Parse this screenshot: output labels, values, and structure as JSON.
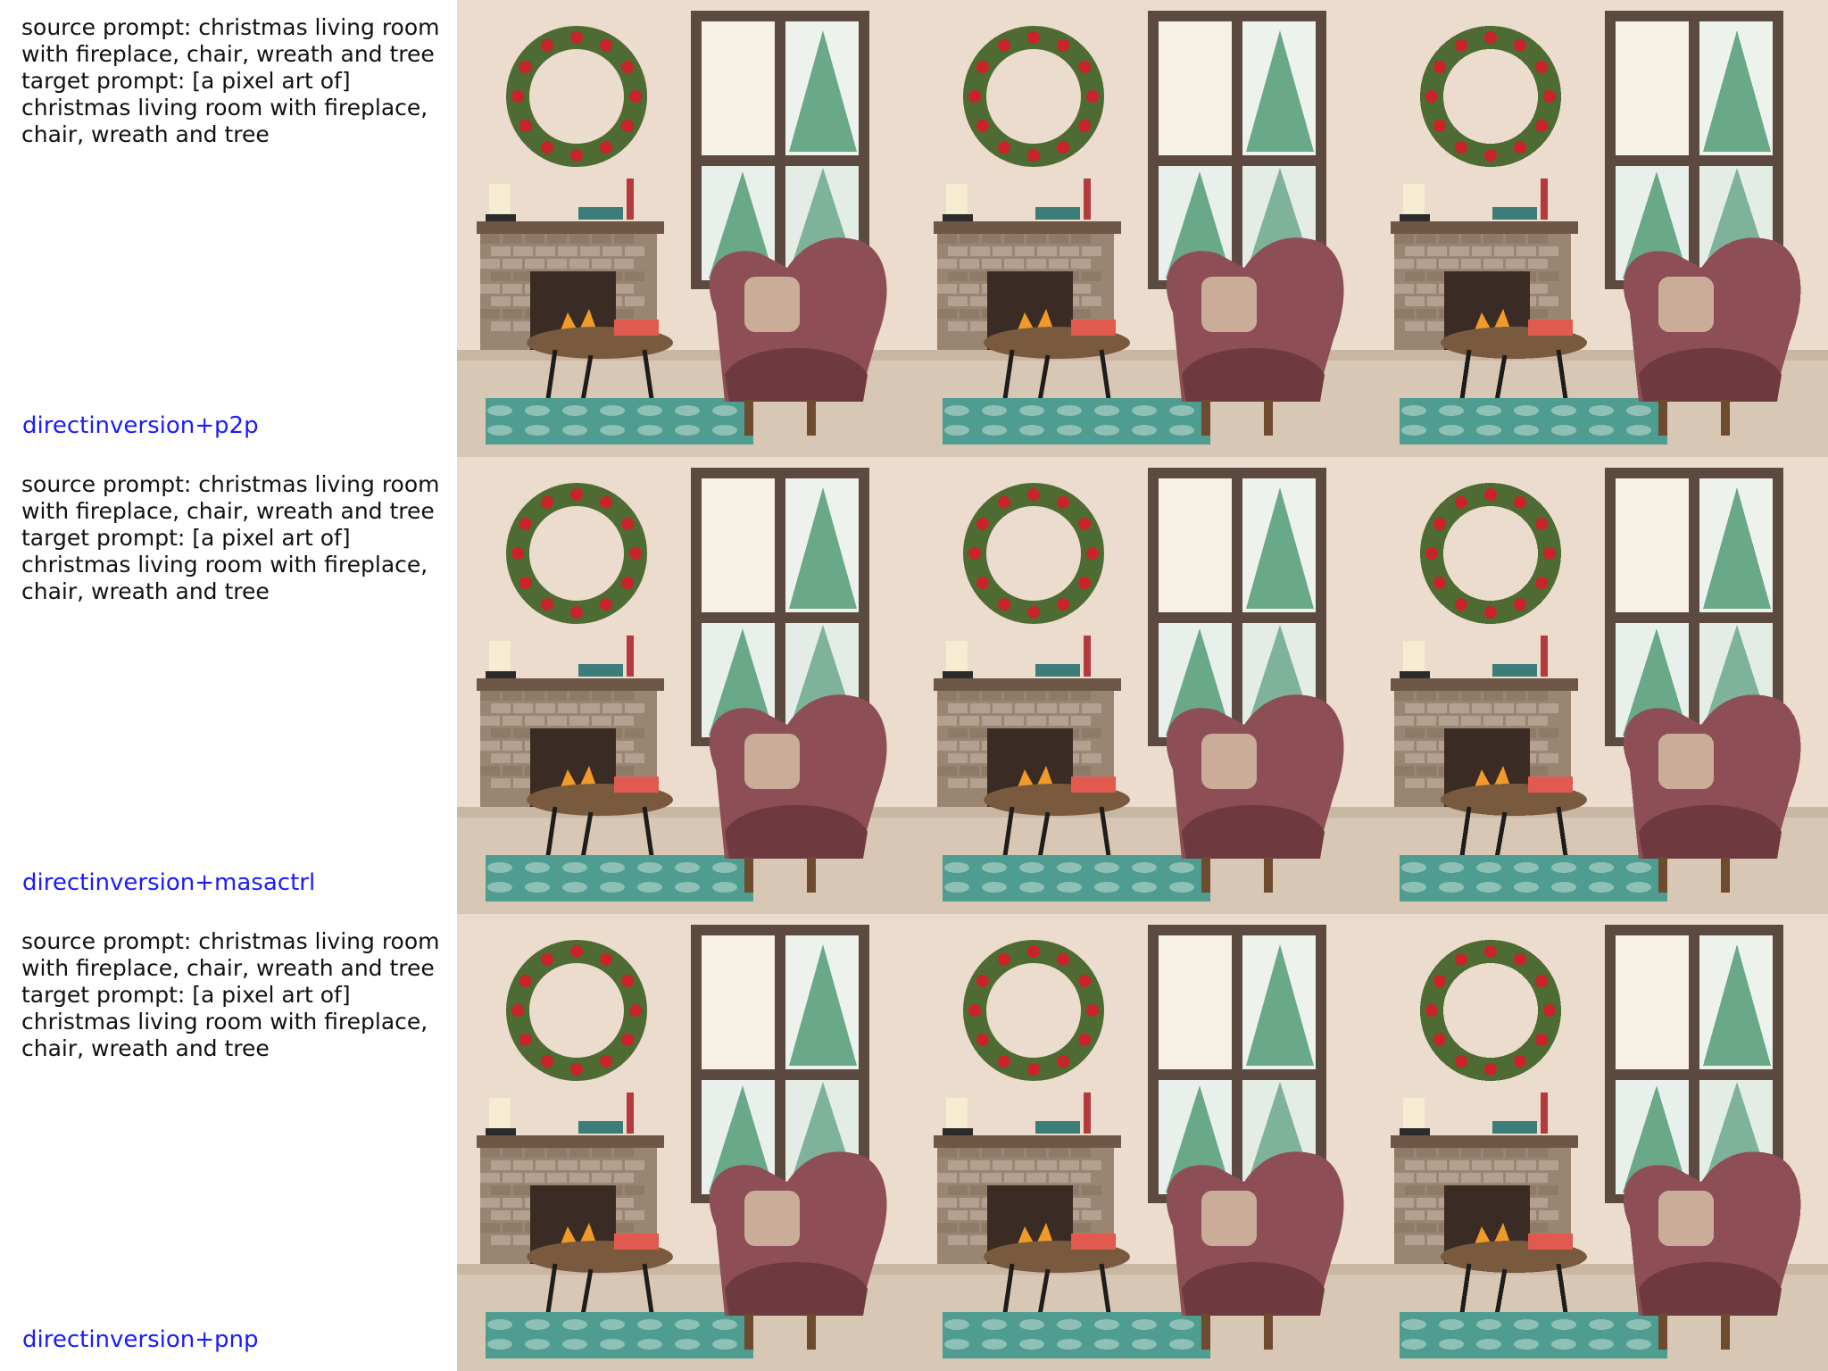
{
  "rows": [
    {
      "caption_lines": [
        "source prompt: christmas living room",
        "with fireplace, chair, wreath and tree",
        "target prompt: [a pixel art of]",
        "christmas living room with fireplace,",
        "chair, wreath and tree"
      ],
      "method": "directinversion+p2p",
      "panels": [
        "source-image",
        "reconstruction-image",
        "edited-pixel-art-image"
      ]
    },
    {
      "caption_lines": [
        "source prompt: christmas living room",
        "with fireplace, chair, wreath and tree",
        "target prompt: [a pixel art of]",
        "christmas living room with fireplace,",
        "chair, wreath and tree"
      ],
      "method": "directinversion+masactrl",
      "panels": [
        "source-image",
        "reconstruction-image",
        "edited-pixel-art-image"
      ]
    },
    {
      "caption_lines": [
        "source prompt: christmas living room",
        "with fireplace, chair, wreath and tree",
        "target prompt: [a pixel art of]",
        "christmas living room with fireplace,",
        "chair, wreath and tree"
      ],
      "method": "directinversion+pnp",
      "panels": [
        "source-image",
        "reconstruction-image",
        "edited-pixel-art-image"
      ]
    }
  ],
  "colors": {
    "wall": "#ecdccd",
    "window_frame": "#5c4a40",
    "tree": "#6aa88a",
    "wreath": "#4f6b34",
    "berry": "#c8242a",
    "brick": "#9a8573",
    "chair": "#8d4e55",
    "rug": "#4f9c90",
    "floor": "#d9c7b5",
    "method_label": "#1a1aff"
  }
}
